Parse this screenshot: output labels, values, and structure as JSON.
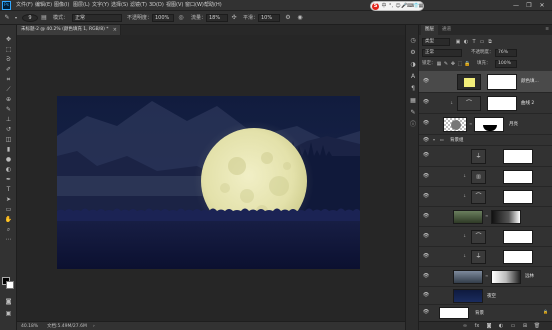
{
  "menubar": {
    "items": [
      "文件(F)",
      "编辑(E)",
      "图像(I)",
      "图层(L)",
      "文字(Y)",
      "选择(S)",
      "滤镜(T)",
      "3D(D)",
      "视图(V)",
      "窗口(W)",
      "帮助(H)"
    ],
    "logo": "Ps",
    "window_controls": {
      "minimize": "—",
      "maximize": "❐",
      "close": "✕"
    }
  },
  "ime": {
    "logo": "S",
    "lang": "中",
    "icons": [
      "°,",
      "☺",
      "🎤",
      "⌨",
      "👕",
      "▦"
    ]
  },
  "options": {
    "brush_size": "9",
    "mode_label": "模式：",
    "mode_value": "正常",
    "opacity_label": "不透明度：",
    "opacity_value": "100%",
    "flow_label": "流量：",
    "flow_value": "18%",
    "smooth_label": "平滑：",
    "smooth_value": "10%"
  },
  "document_tab": {
    "title": "未标题-2 @ 40.2% (颜色填充 1, RGB/8) *",
    "close": "×"
  },
  "status": {
    "zoom": "40.18%",
    "doc": "文档:5.49M/27.6M"
  },
  "panels": {
    "tabs": [
      "图层",
      "通道"
    ],
    "kind_filter": "类型",
    "blend_mode": "正常",
    "opacity_label": "不透明度：",
    "opacity_value": "76%",
    "lock_label": "锁定：",
    "fill_label": "填充：",
    "fill_value": "100%"
  },
  "layers": [
    {
      "name": "颜色填...",
      "type": "fill",
      "color": "#f2ee7a",
      "selected": true
    },
    {
      "name": "曲线 2",
      "type": "adjust"
    },
    {
      "name": "月亮",
      "type": "moon"
    },
    {
      "name": "背景组",
      "type": "group"
    },
    {
      "name": "",
      "type": "adjust"
    },
    {
      "name": "",
      "type": "adjust"
    },
    {
      "name": "",
      "type": "adjust"
    },
    {
      "name": "",
      "type": "photo"
    },
    {
      "name": "",
      "type": "adjust"
    },
    {
      "name": "",
      "type": "adjust"
    },
    {
      "name": "远林",
      "type": "photo"
    },
    {
      "name": "夜空",
      "type": "sky"
    },
    {
      "name": "背景",
      "type": "white"
    }
  ],
  "colors": {
    "ui_bg": "#323232",
    "canvas_bg": "#262626",
    "moon": "#e9e7b8",
    "night_sky": "#0d1633",
    "fill_swatch": "#f2ee7a"
  },
  "tool_icons": [
    "move-icon",
    "marquee-icon",
    "lasso-icon",
    "quick-select-icon",
    "crop-icon",
    "eyedropper-icon",
    "healing-icon",
    "brush-icon",
    "stamp-icon",
    "history-brush-icon",
    "eraser-icon",
    "gradient-icon",
    "blur-icon",
    "dodge-icon",
    "pen-icon",
    "type-icon",
    "path-select-icon",
    "shape-icon",
    "hand-icon",
    "zoom-icon",
    "more-icon"
  ]
}
